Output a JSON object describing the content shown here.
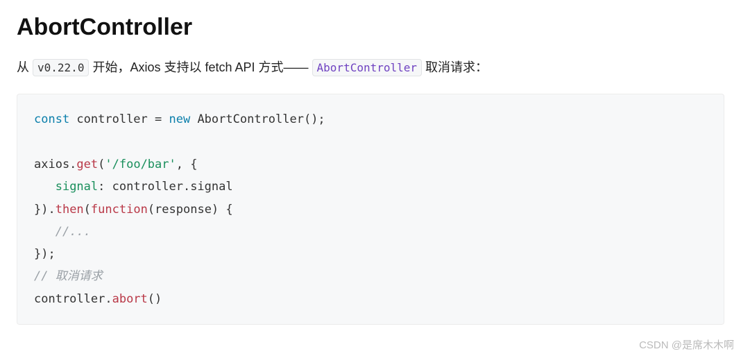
{
  "heading": "AbortController",
  "intro": {
    "t1": "从 ",
    "version": "v0.22.0",
    "t2": " 开始，Axios 支持以 fetch API 方式—— ",
    "link": "AbortController",
    "t3": " 取消请求："
  },
  "code": {
    "l1_const": "const",
    "l1_rest": " controller = ",
    "l1_new": "new",
    "l1_rest2": " AbortController();",
    "l2_axios": "axios.",
    "l2_get": "get",
    "l2_open": "(",
    "l2_str": "'/foo/bar'",
    "l2_rest": ", {",
    "l3_indent": "   ",
    "l3_prop": "signal",
    "l3_rest": ": controller.signal",
    "l4": "}).",
    "l4_then": "then",
    "l4_open": "(",
    "l4_func": "function",
    "l4_rest": "(response) {",
    "l5_indent": "   ",
    "l5_cmt": "//...",
    "l6": "});",
    "l7_cmt": "// 取消请求",
    "l8_ctrl": "controller.",
    "l8_abort": "abort",
    "l8_rest": "()"
  },
  "watermark": "CSDN @是席木木啊"
}
